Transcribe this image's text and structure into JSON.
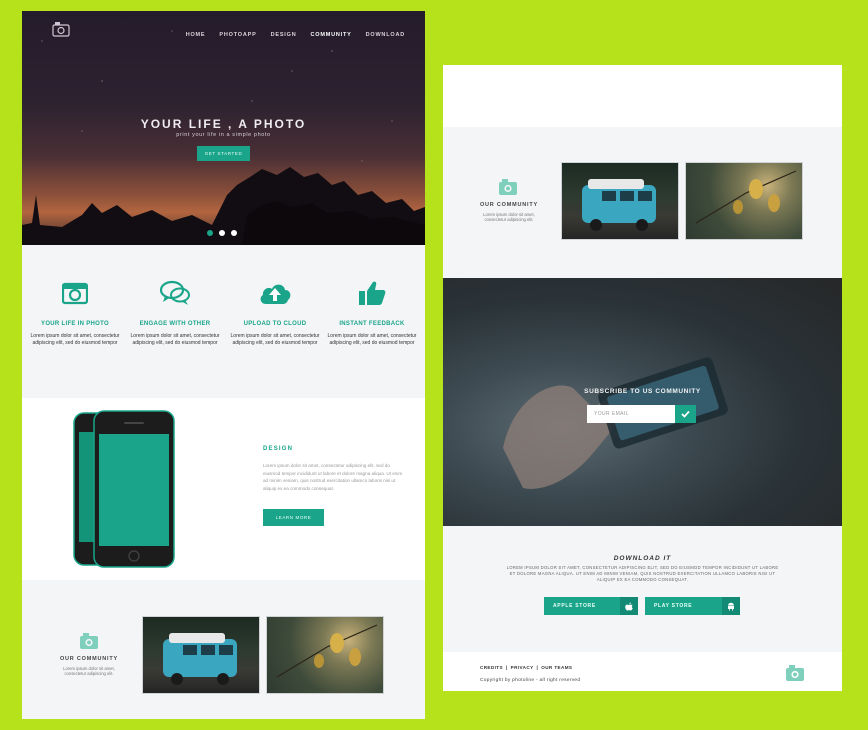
{
  "left_page": {
    "nav": {
      "items": [
        "HOME",
        "PHOTOAPP",
        "DESIGN",
        "COMMUNITY",
        "DOWNLOAD"
      ],
      "active_index": 3
    },
    "hero": {
      "title": "YOUR LIFE , A PHOTO",
      "subtitle": "print your life in a simple photo",
      "button": "GET STARTED",
      "slide_count": 3,
      "active_slide": 0
    },
    "features": [
      {
        "icon": "camera-icon",
        "title": "YOUR LIFE IN PHOTO",
        "text": "Lorem ipsum dolor sit amet, consectetur adipiscing elit, sed do eiusmod tempor"
      },
      {
        "icon": "chat-bubbles-icon",
        "title": "ENGAGE WITH OTHER",
        "text": "Lorem ipsum dolor sit amet, consectetur adipiscing elit, sed do eiusmod tempor"
      },
      {
        "icon": "cloud-upload-icon",
        "title": "UPLOAD TO CLOUD",
        "text": "Lorem ipsum dolor sit amet, consectetur adipiscing elit, sed do eiusmod tempor"
      },
      {
        "icon": "thumbs-up-icon",
        "title": "INSTANT FEEDBACK",
        "text": "Lorem ipsum dolor sit amet, consectetur adipiscing elit, sed do eiusmod tempor"
      }
    ],
    "design": {
      "title": "DESIGN",
      "text": "Lorem ipsum dolor sit amet, consectetur adipiscing elit, sed do eiusmod tempor incididunt ut labore et dolore magna aliqua. Ut enim ad minim veniam, quis nostrud exercitation ullamco laboris nisi ut aliquip ex ea commodo consequat.",
      "button": "LEARN MORE"
    },
    "community": {
      "title": "OUR COMMUNITY",
      "text": "Lorem ipsum dolor sit amet, consectetur adipiscing elit."
    }
  },
  "right_page": {
    "community": {
      "title": "OUR COMMUNITY",
      "text": "Lorem ipsum dolor sit amet, consectetur adipiscing elit."
    },
    "subscribe": {
      "title": "SUBSCRIBE TO US COMMUNITY",
      "placeholder": "YOUR EMAIL"
    },
    "download": {
      "title": "DOWNLOAD IT",
      "text": "LOREM IPSUM DOLOR SIT AMET, CONSECTETUR ADIPISCING ELIT, SED DO EIUSMOD TEMPOR INCIDIDUNT UT LABORE ET DOLORE MAGNA ALIQUA. UT ENIM AD MINIM VENIAM, QUIS NOSTRUD EXERCITATION ULLAMCO LABORIS NISI UT ALIQUIP EX EA COMMODO CONSEQUAT.",
      "apple": "APPLE STORE",
      "play": "PLAY STORE"
    },
    "footer": {
      "links": [
        "CREDITS",
        "PRIVACY",
        "OUR TEAMS"
      ],
      "separator": "|",
      "copyright": "Copyright by photoline - all right reserved"
    }
  },
  "colors": {
    "accent": "#1aa58a",
    "accent_dark": "#138a73",
    "page_bg": "#b6e21c",
    "section_bg": "#f3f5f7"
  }
}
